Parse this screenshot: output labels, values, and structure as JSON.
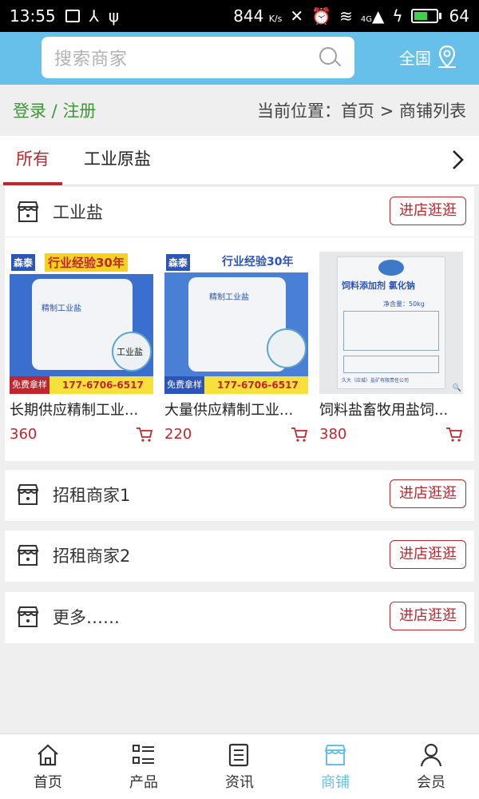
{
  "status_bar": {
    "time": "13:55",
    "speed": "844",
    "speed_unit": "K/s",
    "network": "4G",
    "battery": "64"
  },
  "search": {
    "placeholder": "搜索商家"
  },
  "region": {
    "label": "全国"
  },
  "breadcrumb": {
    "login": "登录",
    "separator": " / ",
    "register": "注册",
    "location": "当前位置：首页 > 商铺列表"
  },
  "tabs": [
    {
      "label": "所有",
      "active": true
    },
    {
      "label": "工业原盐",
      "active": false
    }
  ],
  "shops": [
    {
      "name": "工业盐",
      "enter_label": "进店逛逛",
      "products": [
        {
          "title": "长期供应精制工业...",
          "price": "360",
          "image_text": {
            "brand": "森泰",
            "headline": "行业经验30年",
            "bag": "精制工业盐",
            "tag": "工业盐",
            "badge": "免费拿样",
            "phone": "177-6706-6517"
          }
        },
        {
          "title": "大量供应精制工业...",
          "price": "220",
          "image_text": {
            "brand": "森泰",
            "headline": "行业经验30年",
            "bag": "精制工业盐",
            "badge": "免费拿样",
            "phone": "177-6706-6517"
          }
        },
        {
          "title": "饲料盐畜牧用盐饲...",
          "price": "380",
          "image_text": {
            "bag": "饲料添加剂 氯化钠",
            "net": "净含量：50kg",
            "maker": "久大（应城）盐矿有限责任公司"
          }
        }
      ]
    },
    {
      "name": "招租商家1",
      "enter_label": "进店逛逛"
    },
    {
      "name": "招租商家2",
      "enter_label": "进店逛逛"
    },
    {
      "name": "更多……",
      "enter_label": "进店逛逛"
    }
  ],
  "bottom_nav": [
    {
      "label": "首页",
      "icon": "home-icon",
      "active": false
    },
    {
      "label": "产品",
      "icon": "list-icon",
      "active": false
    },
    {
      "label": "资讯",
      "icon": "news-icon",
      "active": false
    },
    {
      "label": "商铺",
      "icon": "store-icon",
      "active": true
    },
    {
      "label": "会员",
      "icon": "user-icon",
      "active": false
    }
  ],
  "colors": {
    "topbar": "#67c0e9",
    "accent_red": "#c0262d",
    "login_green": "#3b9a33",
    "active_nav": "#67c0e9"
  }
}
